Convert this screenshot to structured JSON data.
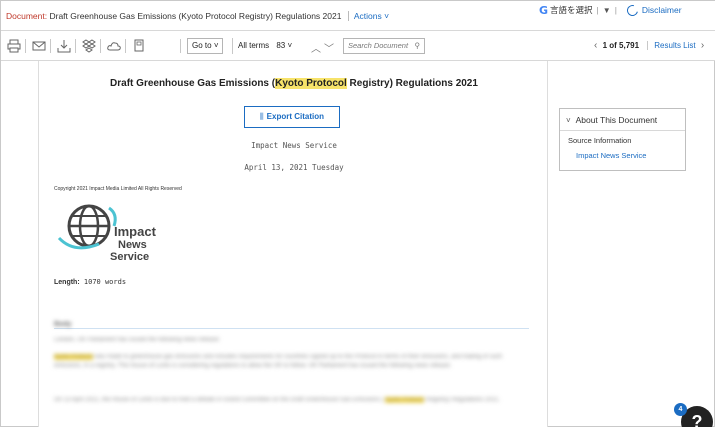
{
  "titlebar": {
    "doc_label": "Document:",
    "doc_title": "Draft Greenhouse Gas Emissions (Kyoto Protocol Registry) Regulations 2021",
    "actions_label": "Actions",
    "translate_label": "言語を選択",
    "translate_arrow": "▼",
    "disclaimer_label": "Disclaimer"
  },
  "toolbar": {
    "icons": [
      "print-icon",
      "email-icon",
      "download-icon",
      "dropbox-icon",
      "cloud-icon",
      "copy-icon"
    ],
    "goto_label": "Go to",
    "all_terms_label": "All terms",
    "all_terms_count": "83",
    "search_placeholder": "Search Document",
    "pager_text": "1 of 5,791",
    "results_list_label": "Results List"
  },
  "document": {
    "title_pre": "Draft Greenhouse Gas Emissions (",
    "title_highlight": "Kyoto Protocol",
    "title_post": " Registry) Regulations 2021",
    "export_label": "Export Citation",
    "source": "Impact News Service",
    "date": "April 13, 2021 Tuesday",
    "copyright": "Copyright 2021 Impact Media Limited All Rights Reserved",
    "logo_text_1": "Impact",
    "logo_text_2": "News",
    "logo_text_3": "Service",
    "length_label": "Length:",
    "length_value": "1070 words",
    "body_label": "Body",
    "blurred_p1": "London, UK Parliament has issued the following news release:",
    "blurred_p2_hl": "Kyoto Protocol",
    "blurred_p2": "was made to greenhouse gas emissions and includes requirements for countries signed up to the Protocol in terms of their emissions, and trading of such emissions, in a registry. This house of Lords is considering regulations to allow the UK to follow. UK Parliament has issued the following news release:",
    "blurred_p3": "On 13 April 2021, the House of Lords is due to hold a debate in Grand Committee on the Draft Greenhouse Gas Emissions (",
    "blurred_p3_hl": "Kyoto Protocol",
    "blurred_p3_post": "Registry) Regulations 2021."
  },
  "sidebar": {
    "panel_title": "About This Document",
    "source_info_label": "Source Information",
    "source_link": "Impact News Service"
  },
  "help": {
    "badge_count": "4",
    "label": "?"
  }
}
